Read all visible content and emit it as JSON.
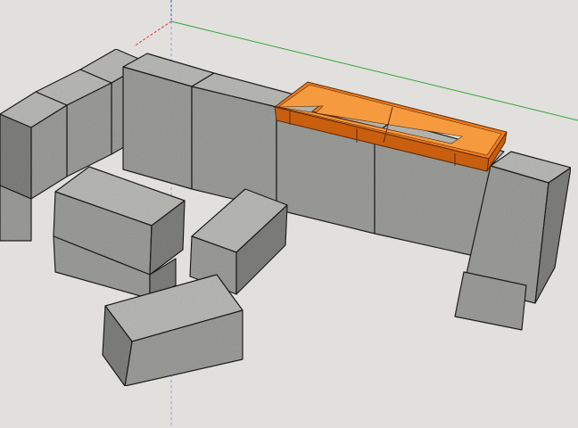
{
  "viewport": {
    "background_color": "#e1e0dd",
    "axes": {
      "red": "#d93a3a",
      "green": "#36a336",
      "blue": "#3a5cd9"
    }
  },
  "materials": {
    "block_top": "#b9bab6",
    "block_front": "#9c9d99",
    "block_side": "#7f807c",
    "edge": "#1c1c1c",
    "tray_fill": "#f07d1e",
    "tray_top": "#f59a3f",
    "tray_shade": "#c85e0e",
    "tray_edge": "#5a2a05"
  },
  "model": {
    "blocks": [
      {
        "name": "wall-block"
      },
      {
        "name": "wall-block"
      },
      {
        "name": "wall-block"
      },
      {
        "name": "wall-block"
      },
      {
        "name": "wall-block"
      },
      {
        "name": "wall-block"
      },
      {
        "name": "wall-block"
      },
      {
        "name": "wall-block"
      },
      {
        "name": "wall-block"
      },
      {
        "name": "loose-block"
      },
      {
        "name": "loose-block"
      },
      {
        "name": "loose-block"
      },
      {
        "name": "loose-block"
      }
    ],
    "selected_component": "fire-pit-insert-tray"
  }
}
